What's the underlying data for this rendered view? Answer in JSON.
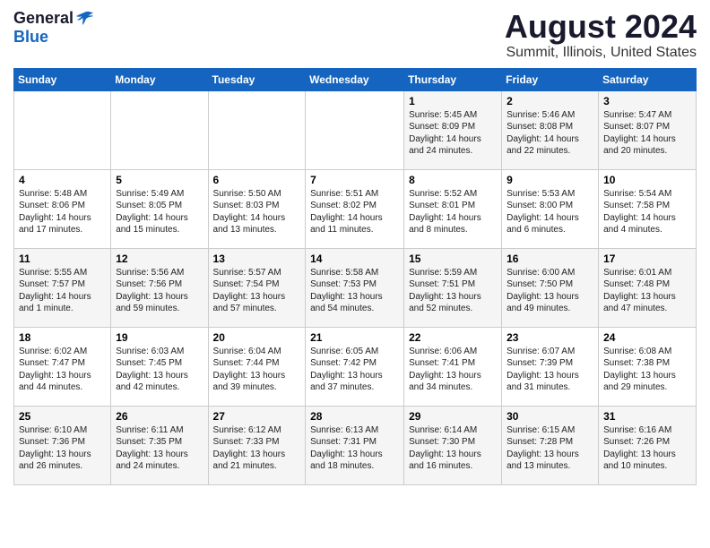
{
  "logo": {
    "general": "General",
    "blue": "Blue"
  },
  "title": "August 2024",
  "location": "Summit, Illinois, United States",
  "days_header": [
    "Sunday",
    "Monday",
    "Tuesday",
    "Wednesday",
    "Thursday",
    "Friday",
    "Saturday"
  ],
  "weeks": [
    [
      {
        "day": "",
        "info": ""
      },
      {
        "day": "",
        "info": ""
      },
      {
        "day": "",
        "info": ""
      },
      {
        "day": "",
        "info": ""
      },
      {
        "day": "1",
        "info": "Sunrise: 5:45 AM\nSunset: 8:09 PM\nDaylight: 14 hours and 24 minutes."
      },
      {
        "day": "2",
        "info": "Sunrise: 5:46 AM\nSunset: 8:08 PM\nDaylight: 14 hours and 22 minutes."
      },
      {
        "day": "3",
        "info": "Sunrise: 5:47 AM\nSunset: 8:07 PM\nDaylight: 14 hours and 20 minutes."
      }
    ],
    [
      {
        "day": "4",
        "info": "Sunrise: 5:48 AM\nSunset: 8:06 PM\nDaylight: 14 hours and 17 minutes."
      },
      {
        "day": "5",
        "info": "Sunrise: 5:49 AM\nSunset: 8:05 PM\nDaylight: 14 hours and 15 minutes."
      },
      {
        "day": "6",
        "info": "Sunrise: 5:50 AM\nSunset: 8:03 PM\nDaylight: 14 hours and 13 minutes."
      },
      {
        "day": "7",
        "info": "Sunrise: 5:51 AM\nSunset: 8:02 PM\nDaylight: 14 hours and 11 minutes."
      },
      {
        "day": "8",
        "info": "Sunrise: 5:52 AM\nSunset: 8:01 PM\nDaylight: 14 hours and 8 minutes."
      },
      {
        "day": "9",
        "info": "Sunrise: 5:53 AM\nSunset: 8:00 PM\nDaylight: 14 hours and 6 minutes."
      },
      {
        "day": "10",
        "info": "Sunrise: 5:54 AM\nSunset: 7:58 PM\nDaylight: 14 hours and 4 minutes."
      }
    ],
    [
      {
        "day": "11",
        "info": "Sunrise: 5:55 AM\nSunset: 7:57 PM\nDaylight: 14 hours and 1 minute."
      },
      {
        "day": "12",
        "info": "Sunrise: 5:56 AM\nSunset: 7:56 PM\nDaylight: 13 hours and 59 minutes."
      },
      {
        "day": "13",
        "info": "Sunrise: 5:57 AM\nSunset: 7:54 PM\nDaylight: 13 hours and 57 minutes."
      },
      {
        "day": "14",
        "info": "Sunrise: 5:58 AM\nSunset: 7:53 PM\nDaylight: 13 hours and 54 minutes."
      },
      {
        "day": "15",
        "info": "Sunrise: 5:59 AM\nSunset: 7:51 PM\nDaylight: 13 hours and 52 minutes."
      },
      {
        "day": "16",
        "info": "Sunrise: 6:00 AM\nSunset: 7:50 PM\nDaylight: 13 hours and 49 minutes."
      },
      {
        "day": "17",
        "info": "Sunrise: 6:01 AM\nSunset: 7:48 PM\nDaylight: 13 hours and 47 minutes."
      }
    ],
    [
      {
        "day": "18",
        "info": "Sunrise: 6:02 AM\nSunset: 7:47 PM\nDaylight: 13 hours and 44 minutes."
      },
      {
        "day": "19",
        "info": "Sunrise: 6:03 AM\nSunset: 7:45 PM\nDaylight: 13 hours and 42 minutes."
      },
      {
        "day": "20",
        "info": "Sunrise: 6:04 AM\nSunset: 7:44 PM\nDaylight: 13 hours and 39 minutes."
      },
      {
        "day": "21",
        "info": "Sunrise: 6:05 AM\nSunset: 7:42 PM\nDaylight: 13 hours and 37 minutes."
      },
      {
        "day": "22",
        "info": "Sunrise: 6:06 AM\nSunset: 7:41 PM\nDaylight: 13 hours and 34 minutes."
      },
      {
        "day": "23",
        "info": "Sunrise: 6:07 AM\nSunset: 7:39 PM\nDaylight: 13 hours and 31 minutes."
      },
      {
        "day": "24",
        "info": "Sunrise: 6:08 AM\nSunset: 7:38 PM\nDaylight: 13 hours and 29 minutes."
      }
    ],
    [
      {
        "day": "25",
        "info": "Sunrise: 6:10 AM\nSunset: 7:36 PM\nDaylight: 13 hours and 26 minutes."
      },
      {
        "day": "26",
        "info": "Sunrise: 6:11 AM\nSunset: 7:35 PM\nDaylight: 13 hours and 24 minutes."
      },
      {
        "day": "27",
        "info": "Sunrise: 6:12 AM\nSunset: 7:33 PM\nDaylight: 13 hours and 21 minutes."
      },
      {
        "day": "28",
        "info": "Sunrise: 6:13 AM\nSunset: 7:31 PM\nDaylight: 13 hours and 18 minutes."
      },
      {
        "day": "29",
        "info": "Sunrise: 6:14 AM\nSunset: 7:30 PM\nDaylight: 13 hours and 16 minutes."
      },
      {
        "day": "30",
        "info": "Sunrise: 6:15 AM\nSunset: 7:28 PM\nDaylight: 13 hours and 13 minutes."
      },
      {
        "day": "31",
        "info": "Sunrise: 6:16 AM\nSunset: 7:26 PM\nDaylight: 13 hours and 10 minutes."
      }
    ]
  ]
}
